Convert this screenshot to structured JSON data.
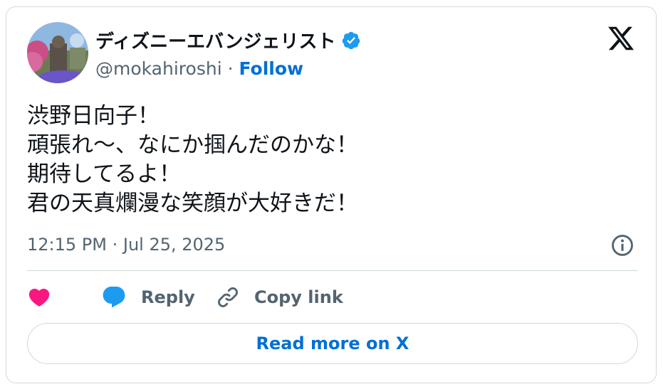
{
  "author": {
    "display_name": "ディズニーエバンジェリスト",
    "handle": "@mokahiroshi",
    "separator": " · ",
    "follow_label": "Follow"
  },
  "tweet": {
    "lines": [
      "渋野日向子！",
      "頑張れ〜、なにか掴んだのかな！",
      "期待してるよ！",
      "君の天真爛漫な笑顔が大好きだ！"
    ],
    "timestamp": "12:15 PM · Jul 25, 2025"
  },
  "actions": {
    "like_label": "",
    "reply_label": "Reply",
    "copy_link_label": "Copy link"
  },
  "read_more_label": "Read more on X",
  "colors": {
    "like": "#f91880",
    "reply": "#1d9bf0",
    "link_blue": "#006fd6",
    "muted": "#536471",
    "border": "#cfd9de"
  },
  "icons": [
    "verified-badge-icon",
    "x-logo-icon",
    "info-icon",
    "heart-icon",
    "reply-bubble-icon",
    "link-icon"
  ]
}
